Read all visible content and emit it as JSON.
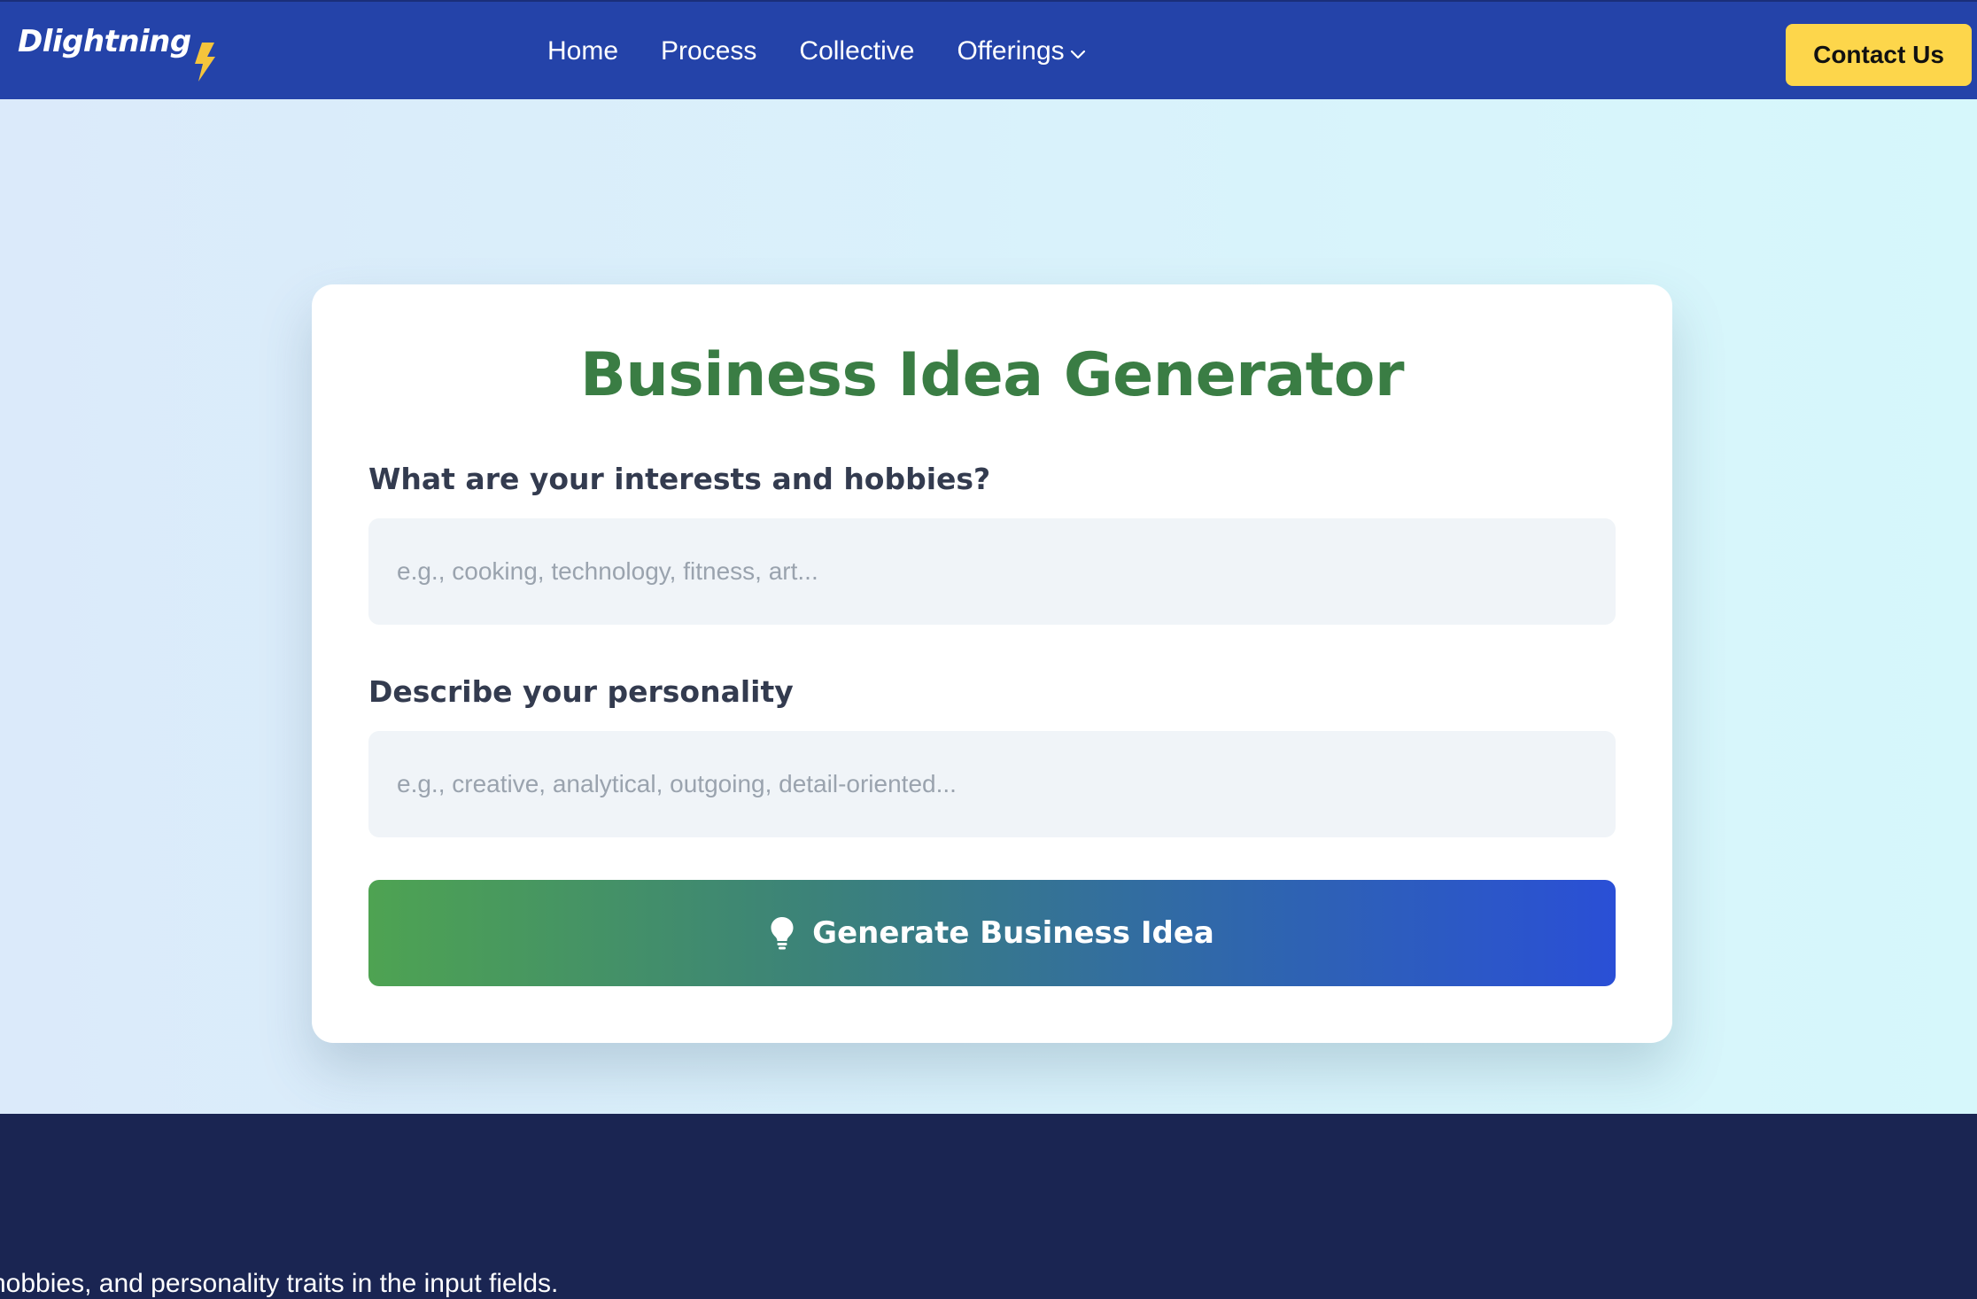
{
  "nav": {
    "logo_text": "Dlightning",
    "links": [
      {
        "label": "Home"
      },
      {
        "label": "Process"
      },
      {
        "label": "Collective"
      },
      {
        "label": "Offerings"
      }
    ],
    "contact_label": "Contact Us"
  },
  "card": {
    "title": "Business Idea Generator",
    "interests_label": "What are your interests and hobbies?",
    "interests_placeholder": "e.g., cooking, technology, fitness, art...",
    "interests_value": "",
    "personality_label": "Describe your personality",
    "personality_placeholder": "e.g., creative, analytical, outgoing, detail-oriented...",
    "personality_value": "",
    "generate_label": "Generate Business Idea"
  },
  "footer": {
    "text": "hobbies, and personality traits in the input fields."
  },
  "colors": {
    "nav_bg": "#2443a9",
    "contact_bg": "#fdd64b",
    "title_green": "#3a7d44",
    "footer_bg": "#1a2552"
  },
  "icons": {
    "logo": "lightning-bolt-icon",
    "dropdown": "chevron-down-icon",
    "generate": "lightbulb-icon"
  }
}
